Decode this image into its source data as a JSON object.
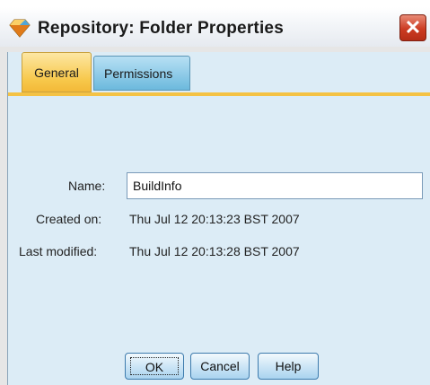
{
  "window": {
    "title": "Repository: Folder Properties",
    "title_icon": "repository-diamond-icon",
    "close_icon": "close-x-icon"
  },
  "tabs": [
    {
      "label": "General",
      "active": true
    },
    {
      "label": "Permissions",
      "active": false
    }
  ],
  "form": {
    "name_label": "Name:",
    "name_value": "BuildInfo",
    "created_label": "Created on:",
    "created_value": "Thu Jul 12 20:13:23 BST 2007",
    "modified_label": "Last modified:",
    "modified_value": "Thu Jul 12 20:13:28 BST 2007"
  },
  "buttons": {
    "ok_label": "OK",
    "cancel_label": "Cancel",
    "help_label": "Help"
  },
  "colors": {
    "active_tab": "#f7c84b",
    "inactive_tab": "#6cb9dd",
    "panel_bg": "#dcecf6",
    "close_button": "#cc3b22"
  }
}
